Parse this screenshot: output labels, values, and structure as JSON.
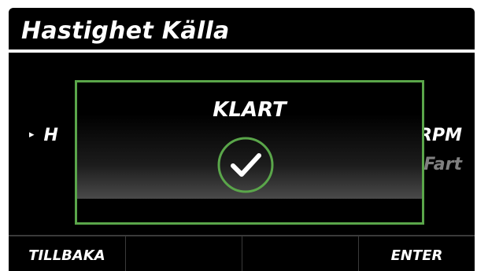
{
  "header": {
    "title": "Hastighet Källa"
  },
  "list": {
    "selected_arrow": "▸",
    "selected_label": "H",
    "right_value_1": "RPM",
    "right_value_2": "Fart"
  },
  "dialog": {
    "title": "KLART",
    "icon": "checkmark-circle-icon",
    "accent_color": "#5aa64a"
  },
  "softkeys": {
    "back_label": "TILLBAKA",
    "key2_label": "",
    "key3_label": "",
    "enter_label": "ENTER"
  }
}
